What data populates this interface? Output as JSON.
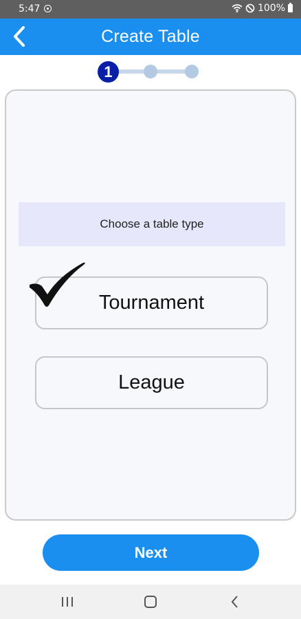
{
  "status_bar": {
    "time": "5:47",
    "battery": "100%",
    "icons": [
      "record-icon",
      "wifi-icon",
      "do-not-disturb-icon",
      "battery-icon"
    ]
  },
  "app_bar": {
    "title": "Create Table",
    "back_icon": "chevron-left-icon"
  },
  "stepper": {
    "current_step": "1",
    "total_steps": 3
  },
  "form": {
    "prompt": "Choose a table type",
    "options": [
      {
        "label": "Tournament",
        "selected": true
      },
      {
        "label": "League",
        "selected": false
      }
    ]
  },
  "actions": {
    "next_label": "Next"
  },
  "nav_bar": {
    "buttons": [
      "recent-apps-icon",
      "home-icon",
      "back-icon"
    ]
  },
  "colors": {
    "primary": "#1b8ff0",
    "step_active": "#0a1fa8",
    "step_inactive": "#b4c9e2",
    "prompt_background": "#e6e7fb"
  }
}
